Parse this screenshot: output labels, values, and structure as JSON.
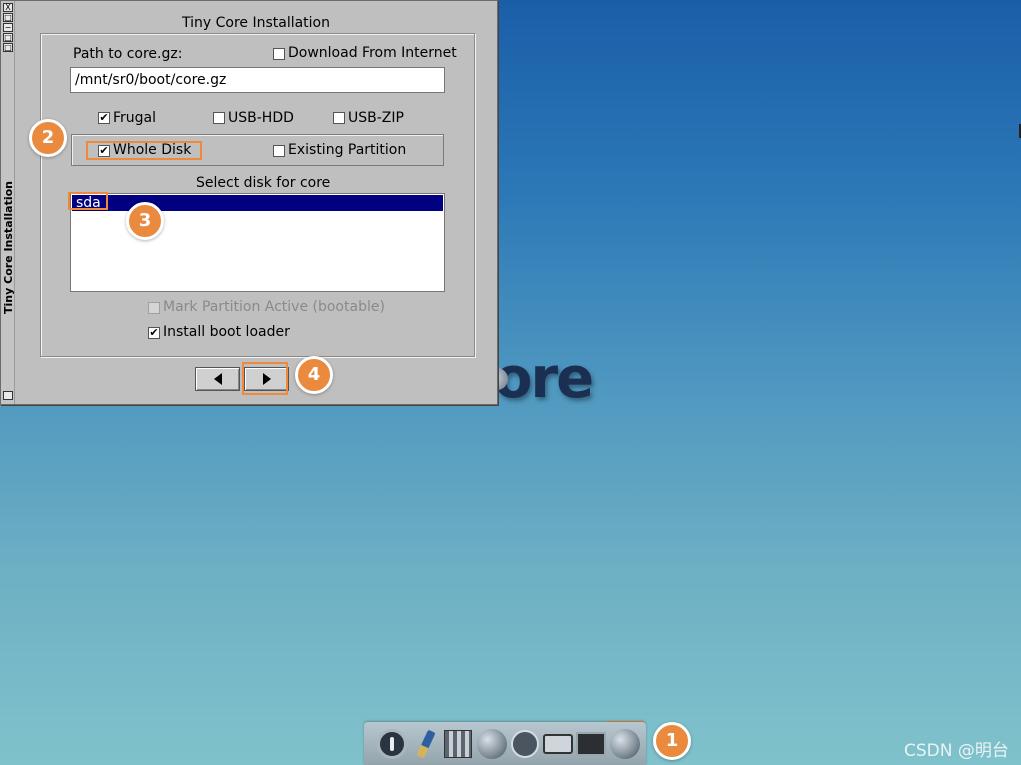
{
  "window": {
    "title": "Tiny Core Installation",
    "side_title": "Tiny Core Installation",
    "side_buttons": [
      "X",
      "□",
      "−",
      "□",
      "□"
    ]
  },
  "path": {
    "label": "Path to core.gz:",
    "value": "/mnt/sr0/boot/core.gz"
  },
  "download": {
    "label": "Download From Internet",
    "checked": false
  },
  "install_type": [
    {
      "label": "Frugal",
      "checked": true
    },
    {
      "label": "USB-HDD",
      "checked": false
    },
    {
      "label": "USB-ZIP",
      "checked": false
    }
  ],
  "target": [
    {
      "label": "Whole Disk",
      "checked": true
    },
    {
      "label": "Existing Partition",
      "checked": false
    }
  ],
  "disk_select": {
    "label": "Select disk for core",
    "items": [
      "sda"
    ],
    "selected": "sda"
  },
  "options": {
    "mark_active": {
      "label": "Mark Partition Active (bootable)",
      "checked": false,
      "enabled": false
    },
    "boot_loader": {
      "label": "Install boot loader",
      "checked": true
    }
  },
  "check_glyph": "✔",
  "annotations": [
    "1",
    "2",
    "3",
    "4"
  ],
  "desktop": {
    "logo_text": "ore"
  },
  "dock_icons": [
    "power-icon",
    "paint-brush-icon",
    "apps-grid-icon",
    "disc-install-icon",
    "run-icon",
    "drive-icon",
    "terminal-icon",
    "tiny-core-installer-icon"
  ],
  "watermark": "CSDN @明台",
  "colors": {
    "accent": "#ea8a3f",
    "selection": "#000080"
  }
}
